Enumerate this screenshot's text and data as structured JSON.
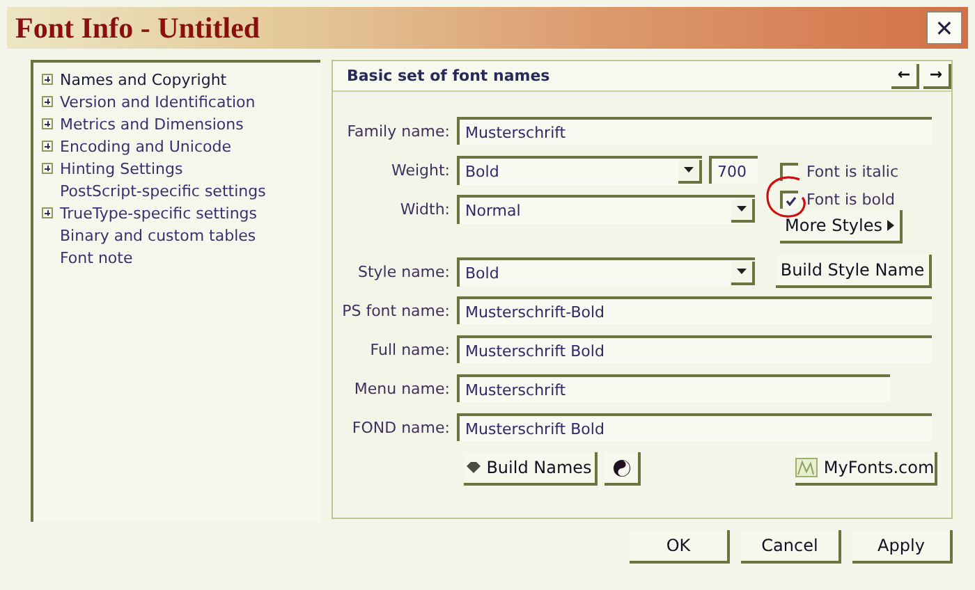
{
  "window": {
    "title": "Font Info - Untitled",
    "close": "✕"
  },
  "tree": [
    {
      "label": "Names and Copyright",
      "expandable": true,
      "selected": true
    },
    {
      "label": "Version and Identification",
      "expandable": true,
      "selected": false
    },
    {
      "label": "Metrics and Dimensions",
      "expandable": true,
      "selected": false
    },
    {
      "label": "Encoding and Unicode",
      "expandable": true,
      "selected": false
    },
    {
      "label": "Hinting Settings",
      "expandable": true,
      "selected": false
    },
    {
      "label": "PostScript-specific settings",
      "expandable": false,
      "selected": false
    },
    {
      "label": "TrueType-specific settings",
      "expandable": true,
      "selected": false
    },
    {
      "label": "Binary and custom tables",
      "expandable": false,
      "selected": false
    },
    {
      "label": "Font note",
      "expandable": false,
      "selected": false
    }
  ],
  "panel": {
    "title": "Basic set of font names",
    "prev": "←",
    "next": "→",
    "family_name": {
      "label": "Family name:",
      "value": "Musterschrift"
    },
    "weight": {
      "label": "Weight:",
      "value": "Bold",
      "number": "700"
    },
    "width": {
      "label": "Width:",
      "value": "Normal"
    },
    "checkboxes": [
      {
        "label": "Font is italic",
        "checked": false,
        "circled": false
      },
      {
        "label": "Font is bold",
        "checked": true,
        "circled": true
      }
    ],
    "more_styles": "More Styles",
    "style_name": {
      "label": "Style name:",
      "value": "Bold"
    },
    "build_style_name": "Build Style Name",
    "names": [
      {
        "label": "PS font name:",
        "value": "Musterschrift-Bold",
        "short": false
      },
      {
        "label": "Full name:",
        "value": "Musterschrift Bold",
        "short": false
      },
      {
        "label": "Menu name:",
        "value": "Musterschrift",
        "short": true
      },
      {
        "label": "FOND name:",
        "value": "Musterschrift Bold",
        "short": false
      }
    ],
    "build_names": "Build Names",
    "myfonts": "MyFonts.com"
  },
  "buttons": [
    "OK",
    "Cancel",
    "Apply"
  ]
}
